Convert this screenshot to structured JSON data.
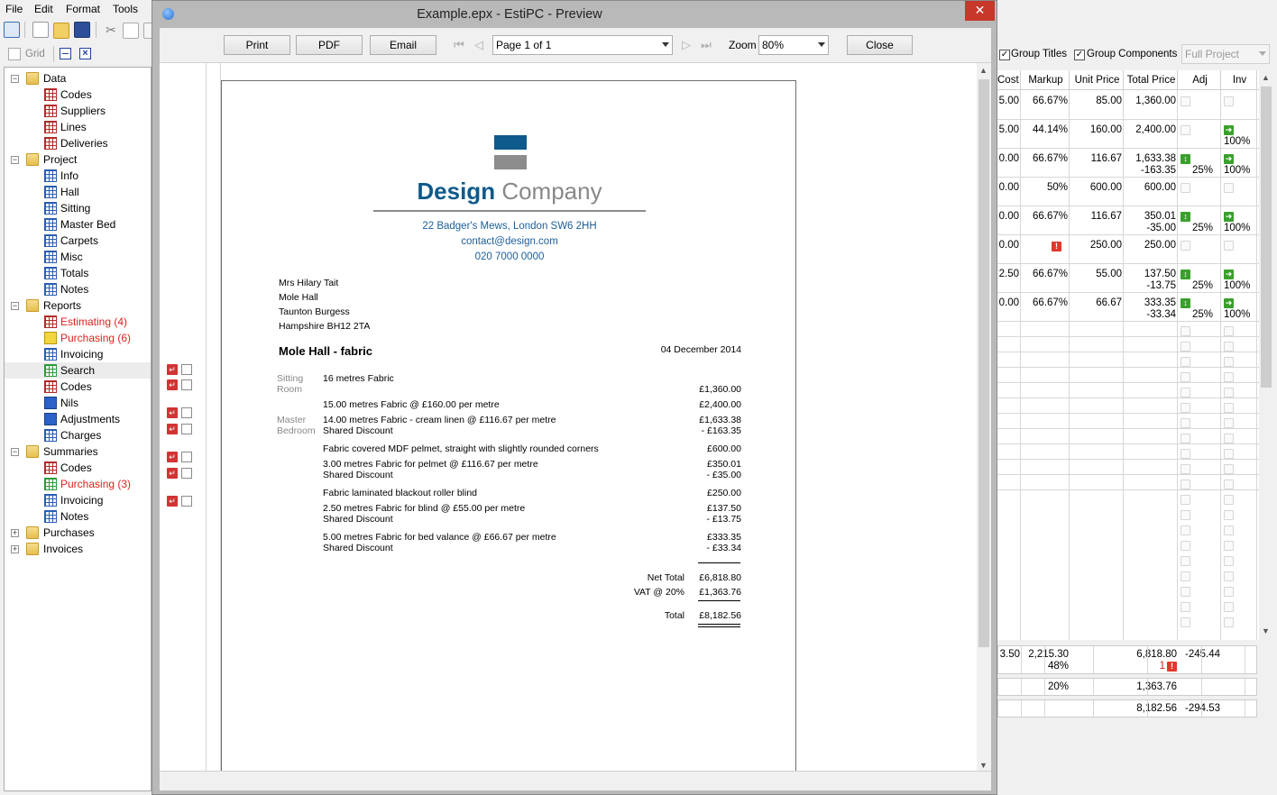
{
  "menu": {
    "file": "File",
    "edit": "Edit",
    "format": "Format",
    "tools": "Tools"
  },
  "toolbar2": {
    "grid_label": "Grid"
  },
  "tree": [
    {
      "label": "Data",
      "type": "folder",
      "level": 0,
      "expand": "−"
    },
    {
      "label": "Codes",
      "type": "grid-red",
      "level": 1
    },
    {
      "label": "Suppliers",
      "type": "grid-red",
      "level": 1
    },
    {
      "label": "Lines",
      "type": "grid-red",
      "level": 1
    },
    {
      "label": "Deliveries",
      "type": "grid-red",
      "level": 1
    },
    {
      "label": "Project",
      "type": "folder",
      "level": 0,
      "expand": "−"
    },
    {
      "label": "Info",
      "type": "grid-blue",
      "level": 1
    },
    {
      "label": "Hall",
      "type": "grid-blue",
      "level": 1
    },
    {
      "label": "Sitting",
      "type": "grid-blue",
      "level": 1
    },
    {
      "label": "Master Bed",
      "type": "grid-blue",
      "level": 1
    },
    {
      "label": "Carpets",
      "type": "grid-blue",
      "level": 1
    },
    {
      "label": "Misc",
      "type": "grid-blue",
      "level": 1
    },
    {
      "label": "Totals",
      "type": "grid-blue",
      "level": 1
    },
    {
      "label": "Notes",
      "type": "grid-blue",
      "level": 1
    },
    {
      "label": "Reports",
      "type": "folder",
      "level": 0,
      "expand": "−"
    },
    {
      "label": "Estimating (4)",
      "type": "grid-red",
      "level": 1,
      "red": true
    },
    {
      "label": "Purchasing (6)",
      "type": "yel",
      "level": 1,
      "red": true
    },
    {
      "label": "Invoicing",
      "type": "grid-blue",
      "level": 1
    },
    {
      "label": "Search",
      "type": "grid-green",
      "level": 1,
      "selected": true
    },
    {
      "label": "Codes",
      "type": "grid-red",
      "level": 1
    },
    {
      "label": "Nils",
      "type": "blu",
      "level": 1
    },
    {
      "label": "Adjustments",
      "type": "blu",
      "level": 1
    },
    {
      "label": "Charges",
      "type": "grid-blue",
      "level": 1
    },
    {
      "label": "Summaries",
      "type": "folder",
      "level": 0,
      "expand": "−"
    },
    {
      "label": "Codes",
      "type": "grid-red",
      "level": 1
    },
    {
      "label": "Purchasing (3)",
      "type": "grid-green",
      "level": 1,
      "red": true
    },
    {
      "label": "Invoicing",
      "type": "grid-blue",
      "level": 1
    },
    {
      "label": "Notes",
      "type": "grid-blue",
      "level": 1
    },
    {
      "label": "Purchases",
      "type": "folder",
      "level": 0,
      "expand": "+"
    },
    {
      "label": "Invoices",
      "type": "folder",
      "level": 0,
      "expand": "+"
    }
  ],
  "right": {
    "group_titles": "Group Titles",
    "group_components": "Group Components",
    "scope": "Full Project",
    "headers": [
      "Cost",
      "Markup",
      "Unit Price",
      "Total Price",
      "Adj",
      "Inv"
    ],
    "rows": [
      {
        "cost": "5.00",
        "markup": "66.67%",
        "unit": "85.00",
        "total": "1,360.00",
        "total2": "",
        "adj": "",
        "adj_icon": "faint",
        "inv_icon": "faint",
        "inv": ""
      },
      {
        "cost": "5.00",
        "markup": "44.14%",
        "unit": "160.00",
        "total": "2,400.00",
        "total2": "",
        "adj": "",
        "adj_icon": "faint",
        "inv_icon": "green",
        "inv": "100%"
      },
      {
        "cost": "0.00",
        "markup": "66.67%",
        "unit": "116.67",
        "total": "1,633.38",
        "total2": "-163.35",
        "adj": "25%",
        "adj_icon": "green",
        "inv_icon": "green",
        "inv": "100%"
      },
      {
        "cost": "0.00",
        "markup": "50%",
        "unit": "600.00",
        "total": "600.00",
        "total2": "",
        "adj": "",
        "adj_icon": "faint",
        "inv_icon": "faint",
        "inv": ""
      },
      {
        "cost": "0.00",
        "markup": "66.67%",
        "unit": "116.67",
        "total": "350.01",
        "total2": "-35.00",
        "adj": "25%",
        "adj_icon": "green",
        "inv_icon": "green",
        "inv": "100%"
      },
      {
        "cost": "0.00",
        "markup": "!",
        "unit": "250.00",
        "total": "250.00",
        "total2": "",
        "adj": "",
        "adj_icon": "faint",
        "inv_icon": "faint",
        "inv": ""
      },
      {
        "cost": "2.50",
        "markup": "66.67%",
        "unit": "55.00",
        "total": "137.50",
        "total2": "-13.75",
        "adj": "25%",
        "adj_icon": "green",
        "inv_icon": "green",
        "inv": "100%"
      },
      {
        "cost": "0.00",
        "markup": "66.67%",
        "unit": "66.67",
        "total": "333.35",
        "total2": "-33.34",
        "adj": "25%",
        "adj_icon": "green",
        "inv_icon": "green",
        "inv": "100%"
      }
    ],
    "summary1": {
      "cost": "3.50",
      "markup": "2,215.30",
      "markup2": "48%",
      "total": "6,818.80",
      "total2": "1",
      "adj": "-245.44"
    },
    "summary2": {
      "markup": "20%",
      "total": "1,363.76"
    },
    "summary3": {
      "total": "8,182.56",
      "adj": "-294.53"
    }
  },
  "preview": {
    "title": "Example.epx - EstiPC - Preview",
    "close_x": "✕",
    "buttons": {
      "print": "Print",
      "pdf": "PDF",
      "email": "Email",
      "close": "Close"
    },
    "page_select": "Page 1 of 1",
    "zoom_label": "Zoom",
    "zoom_value": "80%",
    "doc": {
      "company1": "Design",
      "company2": "Company",
      "address": "22 Badger's Mews, London SW6 2HH",
      "email": "contact@design.com",
      "phone": "020 7000 0000",
      "recipient": [
        "Mrs Hilary Tait",
        "Mole Hall",
        "Taunton Burgess",
        "Hampshire BH12 2TA"
      ],
      "heading": "Mole Hall - fabric",
      "date": "04 December 2014",
      "room_sitting": "Sitting\nRoom",
      "room_master": "Master\nBedroom",
      "items": [
        {
          "desc": "16 metres Fabric",
          "desc2": "",
          "amount": "",
          "amount2": ""
        },
        {
          "desc": "",
          "desc2": "",
          "amount": "£1,360.00",
          "amount2": ""
        },
        {
          "desc": "15.00 metres Fabric @ £160.00 per metre",
          "desc2": "",
          "amount": "£2,400.00",
          "amount2": ""
        },
        {
          "desc": "14.00 metres Fabric - cream linen @ £116.67 per metre",
          "desc2": "Shared Discount",
          "amount": "£1,633.38",
          "amount2": "- £163.35"
        },
        {
          "desc": "Fabric covered MDF pelmet, straight with slightly rounded corners",
          "desc2": "",
          "amount": "£600.00",
          "amount2": ""
        },
        {
          "desc": "3.00 metres Fabric for pelmet @ £116.67 per metre",
          "desc2": "Shared Discount",
          "amount": "£350.01",
          "amount2": "- £35.00"
        },
        {
          "desc": "Fabric laminated blackout roller blind",
          "desc2": "",
          "amount": "£250.00",
          "amount2": ""
        },
        {
          "desc": "2.50 metres Fabric for blind @ £55.00 per metre",
          "desc2": "Shared Discount",
          "amount": "£137.50",
          "amount2": "- £13.75"
        },
        {
          "desc": "5.00 metres Fabric for bed valance @ £66.67 per metre",
          "desc2": "Shared Discount",
          "amount": "£333.35",
          "amount2": "- £33.34"
        }
      ],
      "net_total_label": "Net Total",
      "net_total": "£6,818.80",
      "vat_label": "VAT @ 20%",
      "vat": "£1,363.76",
      "total_label": "Total",
      "total": "£8,182.56"
    }
  },
  "colors": {
    "accent": "#0e5a8a",
    "close_red": "#c7372a",
    "tree_red": "#e02020"
  }
}
